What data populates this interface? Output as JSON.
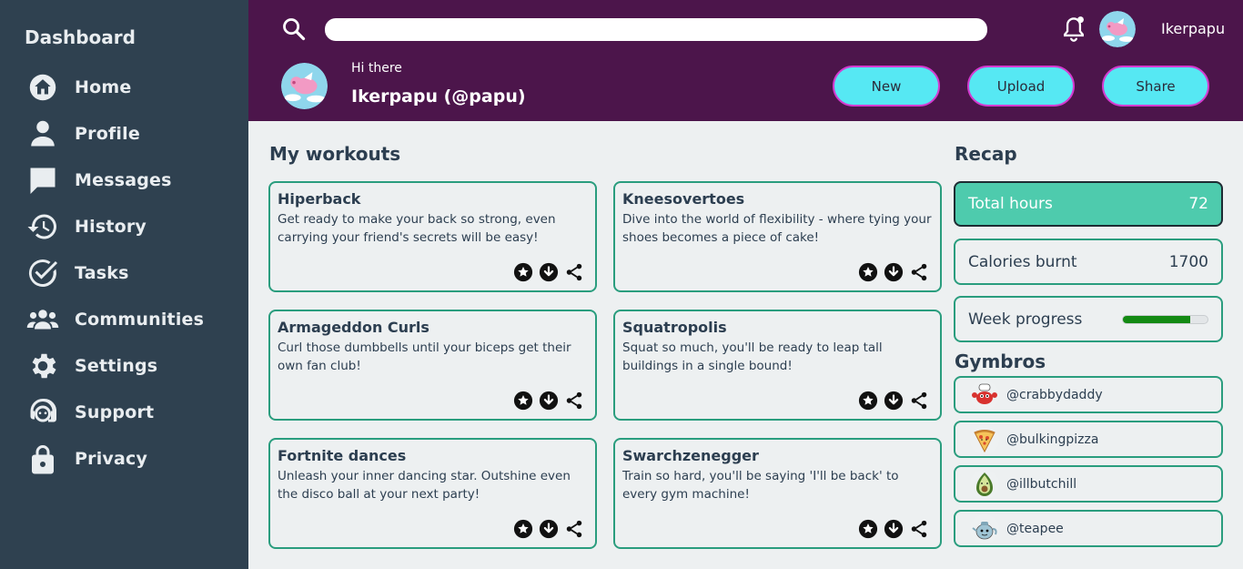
{
  "sidebar": {
    "title": "Dashboard",
    "items": [
      {
        "label": "Home",
        "icon": "home-icon"
      },
      {
        "label": "Profile",
        "icon": "user-icon"
      },
      {
        "label": "Messages",
        "icon": "chat-icon"
      },
      {
        "label": "History",
        "icon": "history-icon"
      },
      {
        "label": "Tasks",
        "icon": "check-icon"
      },
      {
        "label": "Communities",
        "icon": "group-icon"
      },
      {
        "label": "Settings",
        "icon": "gear-icon"
      },
      {
        "label": "Support",
        "icon": "support-icon"
      },
      {
        "label": "Privacy",
        "icon": "lock-icon"
      }
    ]
  },
  "header": {
    "search_placeholder": "",
    "username": "Ikerpapu",
    "greeting": "Hi there",
    "display_name": "Ikerpapu (@papu)",
    "buttons": {
      "new": "New",
      "upload": "Upload",
      "share": "Share"
    }
  },
  "workouts": {
    "title": "My workouts",
    "items": [
      {
        "title": "Hiperback",
        "desc": "Get ready to make your back so strong, even carrying your friend's secrets will be easy!"
      },
      {
        "title": "Kneesovertoes",
        "desc": "Dive into the world of flexibility - where tying your shoes becomes a piece of cake!"
      },
      {
        "title": "Armageddon Curls",
        "desc": "Curl those dumbbells until your biceps get their own fan club!"
      },
      {
        "title": "Squatropolis",
        "desc": "Squat so much, you'll be ready to leap tall buildings in a single bound!"
      },
      {
        "title": "Fortnite dances",
        "desc": "Unleash your inner dancing star. Outshine even the disco ball at your next party!"
      },
      {
        "title": "Swarchzenegger",
        "desc": "Train so hard, you'll be saying 'I'll be back' to every gym machine!"
      }
    ]
  },
  "recap": {
    "title": "Recap",
    "total_hours_label": "Total hours",
    "total_hours_value": "72",
    "calories_label": "Calories burnt",
    "calories_value": "1700",
    "week_progress_label": "Week progress",
    "week_progress_fraction": 0.8
  },
  "gymbros": {
    "title": "Gymbros",
    "items": [
      {
        "handle": "@crabbydaddy"
      },
      {
        "handle": "@bulkingpizza"
      },
      {
        "handle": "@illbutchill"
      },
      {
        "handle": "@teapee"
      }
    ]
  },
  "colors": {
    "sidebar_bg": "#2f4150",
    "header_bg": "#4c154b",
    "accent_button": "#56e8f3",
    "button_border": "#d43bd0",
    "card_border": "#2a9d7e",
    "recap_active": "#4ecbad",
    "progress": "#138a13"
  }
}
